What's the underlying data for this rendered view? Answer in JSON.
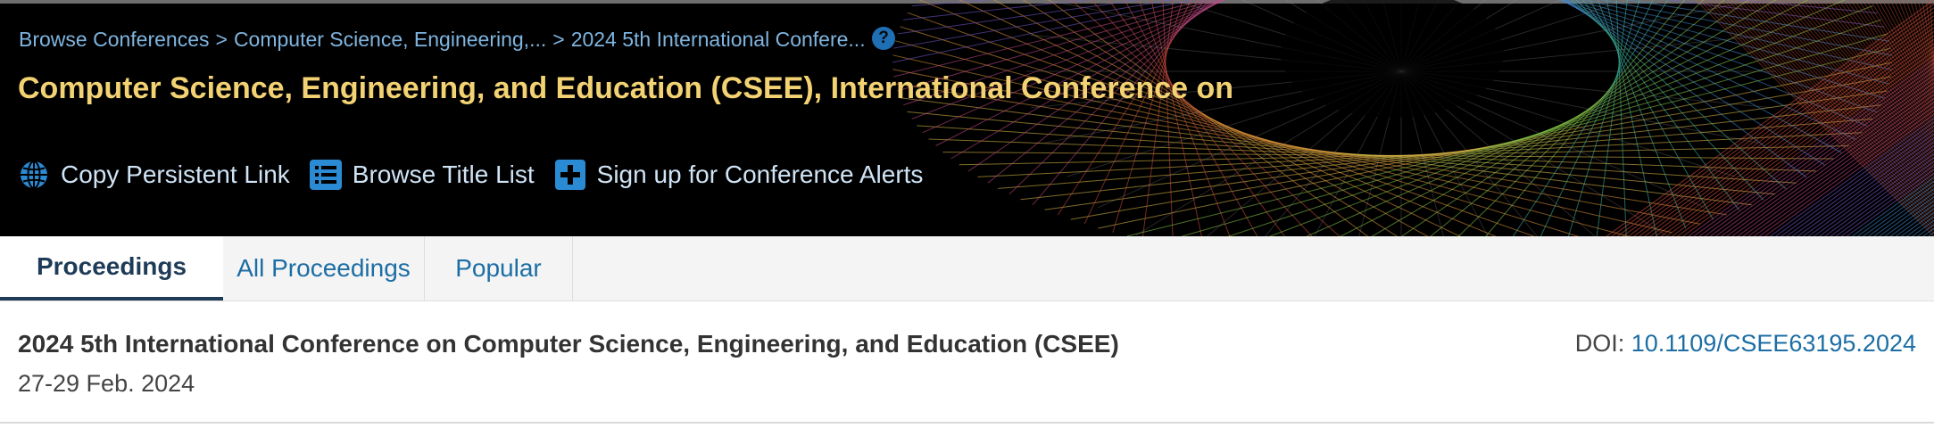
{
  "breadcrumb": {
    "items": [
      "Browse Conferences",
      "Computer Science, Engineering,...",
      "2024 5th International Confere..."
    ],
    "separator": ">",
    "help_symbol": "?"
  },
  "header": {
    "title": "Computer Science, Engineering, and Education (CSEE), International Conference on",
    "actions": [
      {
        "label": "Copy Persistent Link",
        "icon": "globe-icon"
      },
      {
        "label": "Browse Title List",
        "icon": "list-icon"
      },
      {
        "label": "Sign up for Conference Alerts",
        "icon": "plus-icon"
      }
    ]
  },
  "tabs": [
    {
      "label": "Proceedings",
      "active": true
    },
    {
      "label": "All Proceedings",
      "active": false
    },
    {
      "label": "Popular",
      "active": false
    }
  ],
  "proceedings": {
    "title": "2024 5th International Conference on Computer Science, Engineering, and Education (CSEE)",
    "date": "27-29 Feb. 2024",
    "doi_label": "DOI: ",
    "doi_value": "10.1109/CSEE63195.2024"
  },
  "colors": {
    "banner_bg": "#000000",
    "title": "#f2d272",
    "link": "#1c6ea4",
    "active_tab": "#1e3b57",
    "icon_blue": "#2a8ad4"
  }
}
